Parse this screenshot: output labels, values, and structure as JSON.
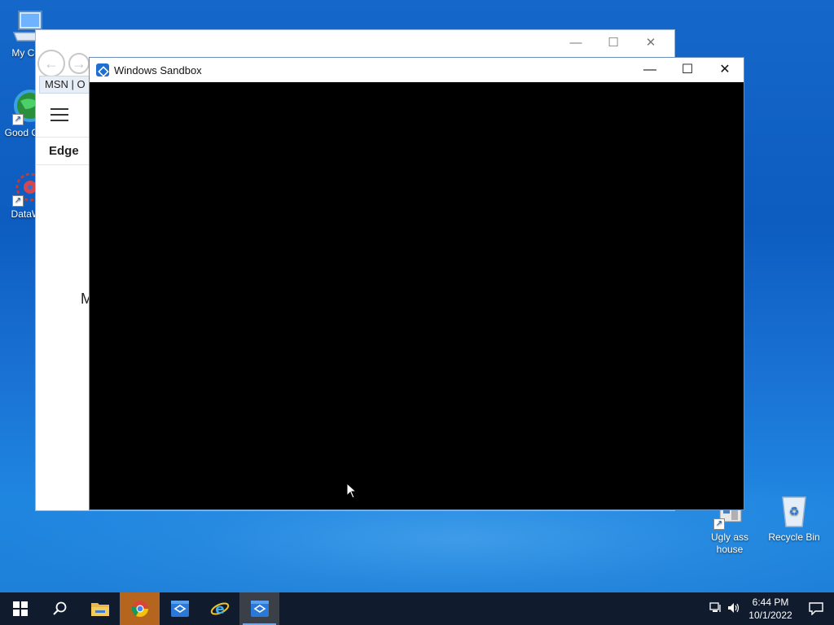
{
  "desktop": {
    "icons": [
      {
        "label": "My Con",
        "name": "desktop-icon-my-computer"
      },
      {
        "label": "Good Chro",
        "name": "desktop-icon-google-chrome"
      },
      {
        "label": "DataWa",
        "name": "desktop-icon-datawarrior"
      },
      {
        "label": "Ugly ass house",
        "name": "desktop-icon-ugly-ass-house"
      },
      {
        "label": "Recycle Bin",
        "name": "desktop-icon-recycle-bin"
      }
    ]
  },
  "ie_window": {
    "tab_title": "MSN | O",
    "nav_label": "Edge",
    "content_text": "M"
  },
  "sandbox_window": {
    "title": "Windows Sandbox",
    "minimize": "—",
    "maximize": "☐",
    "close": "✕"
  },
  "taskbar": {
    "items": [
      "start",
      "search",
      "file-explorer",
      "chrome",
      "windows-sandbox",
      "internet-explorer",
      "windows-sandbox-active"
    ],
    "clock_time": "6:44 PM",
    "clock_date": "10/1/2022"
  },
  "colors": {
    "desktop_bg": "#0d5cc0",
    "taskbar_bg": "#101c2e",
    "sandbox_accent": "#1e6fd0"
  }
}
